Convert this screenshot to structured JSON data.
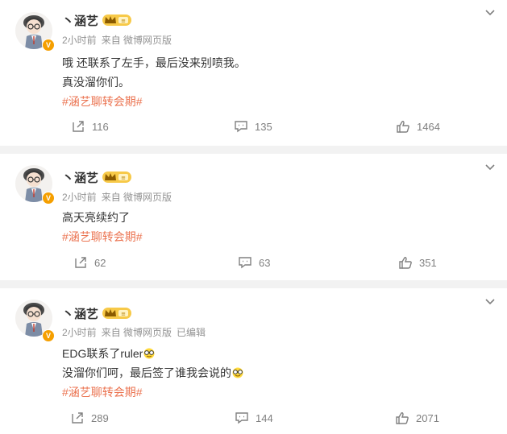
{
  "posts": [
    {
      "author": "丶涵艺",
      "vip_level": "≡",
      "verified_badge": "V",
      "time": "2小时前",
      "source": "来自 微博网页版",
      "edited": "",
      "lines": [
        "哦 还联系了左手，最后没来别喷我。",
        "真没溜你们。"
      ],
      "hashtag": "#涵艺聊转会期#",
      "reposts": "116",
      "comments": "135",
      "likes": "1464"
    },
    {
      "author": "丶涵艺",
      "vip_level": "≡",
      "verified_badge": "V",
      "time": "2小时前",
      "source": "来自 微博网页版",
      "edited": "",
      "lines": [
        "高天亮续约了"
      ],
      "hashtag": "#涵艺聊转会期#",
      "reposts": "62",
      "comments": "63",
      "likes": "351"
    },
    {
      "author": "丶涵艺",
      "vip_level": "≡",
      "verified_badge": "V",
      "time": "2小时前",
      "source": "来自 微博网页版",
      "edited": "已编辑",
      "lines": [
        "EDG联系了ruler",
        "没溜你们呵，最后签了谁我会说的"
      ],
      "hashtag": "#涵艺聊转会期#",
      "reposts": "289",
      "comments": "144",
      "likes": "2071"
    }
  ],
  "icons": {
    "repost": "repost-icon",
    "comment": "comment-icon",
    "like": "thumbs-up-icon",
    "more": "chevron-down-icon",
    "emoji": "glasses-emoji-icon"
  },
  "colors": {
    "hashtag": "#eb7350",
    "meta": "#939393",
    "badge": "#f59f00",
    "separator": "#f2f2f2"
  }
}
